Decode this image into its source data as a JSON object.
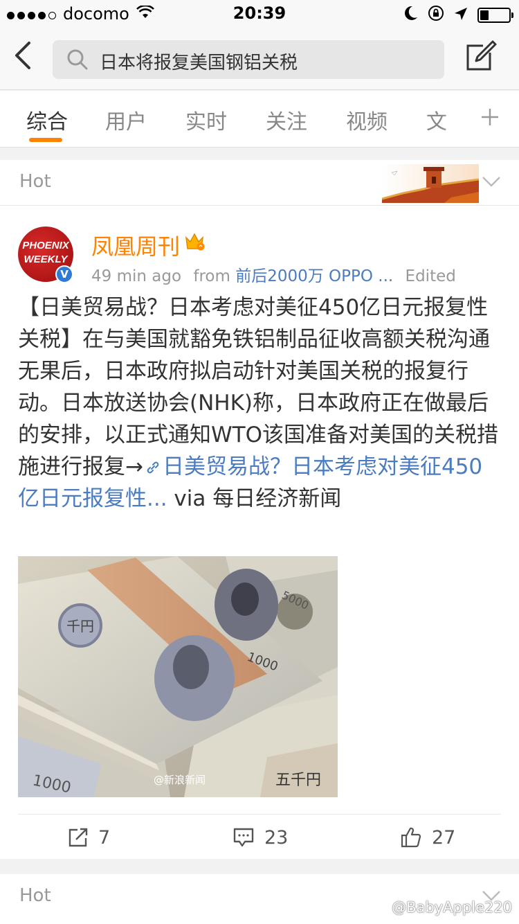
{
  "status_bar": {
    "carrier": "docomo",
    "time": "20:39"
  },
  "search": {
    "query": "日本将报复美国钢铝关税"
  },
  "tabs": [
    {
      "label": "综合"
    },
    {
      "label": "用户"
    },
    {
      "label": "实时"
    },
    {
      "label": "关注"
    },
    {
      "label": "视频"
    },
    {
      "label": "文"
    }
  ],
  "section": {
    "hot_label": "Hot"
  },
  "post": {
    "author": "凤凰周刊",
    "avatar_text": "PHOENIX WEEKLY",
    "verified_mark": "V",
    "time_ago": "49 min ago",
    "from_label": "from",
    "source": "前后2000万 OPPO ...",
    "edited": "Edited",
    "text_body": "【日美贸易战？日本考虑对美征450亿日元报复性关税】在与美国就豁免铁铝制品征收高额关税沟通无果后，日本政府拟启动针对美国关税的报复行动。日本放送协会(NHK)称，日本政府正在做最后的安排，以正式通知WTO该国准备对美国的关税措施进行报复→",
    "link_text": "日美贸易战？日本考虑对美征450亿日元报复性...",
    "via": " via 每日经济新闻",
    "image_watermark": "@新浪新闻",
    "reposts": "7",
    "comments": "23",
    "likes": "27"
  },
  "section2": {
    "hot_label": "Hot"
  },
  "watermark": "@BabyApple220",
  "colors": {
    "accent": "#ff8200",
    "link": "#4b7cc1",
    "verified": "#2e7bd6"
  }
}
